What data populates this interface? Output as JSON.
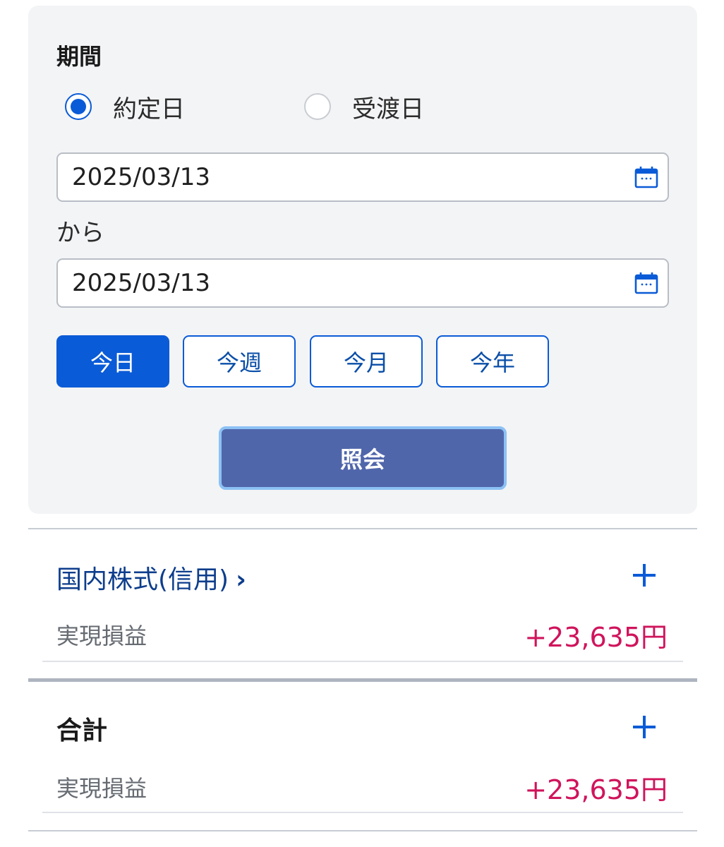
{
  "filter": {
    "period_label": "期間",
    "date_types": [
      {
        "label": "約定日",
        "selected": true
      },
      {
        "label": "受渡日",
        "selected": false
      }
    ],
    "start_date": "2025/03/13",
    "range_separator": "から",
    "end_date": "2025/03/13",
    "quick_ranges": [
      {
        "label": "今日",
        "active": true
      },
      {
        "label": "今週",
        "active": false
      },
      {
        "label": "今月",
        "active": false
      },
      {
        "label": "今年",
        "active": false
      }
    ],
    "submit_label": "照会"
  },
  "sections": [
    {
      "title": "国内株式(信用)",
      "chevron": "›",
      "row_label": "実現損益",
      "row_value": "+23,635円",
      "icon": "plus-icon"
    },
    {
      "title": "合計",
      "row_label": "実現損益",
      "row_value": "+23,635円",
      "icon": "plus-icon"
    }
  ],
  "colors": {
    "accent": "#0a5bd7",
    "submit_bg": "#5066ab",
    "profit": "#d0145c",
    "panel_bg": "#f3f4f6"
  }
}
